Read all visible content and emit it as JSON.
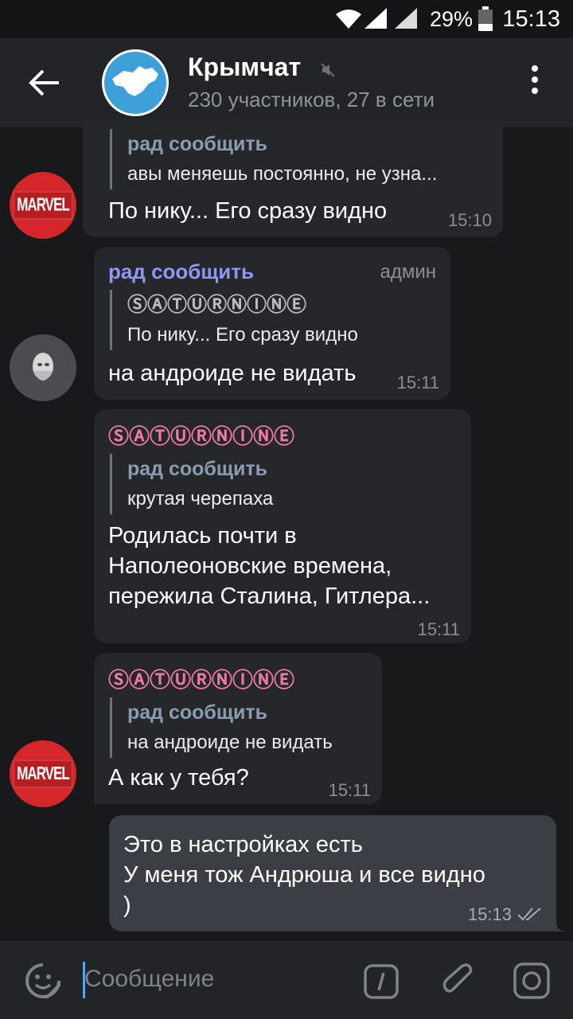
{
  "status_bar": {
    "battery_percent": "29%",
    "time": "15:13",
    "icons": [
      "wifi-icon",
      "signal-icon",
      "signal-icon",
      "battery-icon"
    ]
  },
  "header": {
    "title": "Крымчат",
    "subtitle": "230 участников, 27 в сети",
    "muted": true,
    "avatar_color": "#3da0d9"
  },
  "messages": [
    {
      "avatar": "MARVEL",
      "reply_to": {
        "name": "рад сообщить",
        "text": "авы меняешь постоянно, не узна..."
      },
      "text": "По нику... Его сразу видно",
      "time": "15:10"
    },
    {
      "sender": "рад сообщить",
      "sender_color": "#8e97f5",
      "badge": "админ",
      "reply_to": {
        "name": "ⓈⒶⓉⓊⓇⓃⒾⓃⒺ",
        "text": "По нику... Его сразу видно"
      },
      "text": "на андроиде не видать",
      "time": "15:11"
    },
    {
      "sender": "ⓈⒶⓉⓊⓇⓃⒾⓃⒺ",
      "sender_color": "#f07aa3",
      "reply_to": {
        "name": "рад сообщить",
        "text": "крутая черепаха"
      },
      "text": "Родилась почти в\nНаполеоновские времена,\nпережила Сталина, Гитлера...",
      "time": "15:11"
    },
    {
      "sender": "ⓈⒶⓉⓊⓇⓃⒾⓃⒺ",
      "sender_color": "#f07aa3",
      "avatar": "MARVEL",
      "reply_to": {
        "name": "рад сообщить",
        "text": "на андроиде не видать"
      },
      "text": "А как у тебя?",
      "time": "15:11"
    },
    {
      "own": true,
      "text": "Это в настройках есть\nУ меня тож Андрюша и все видно\n)",
      "time": "15:13",
      "status": "read"
    }
  ],
  "input": {
    "placeholder": "Сообщение"
  }
}
